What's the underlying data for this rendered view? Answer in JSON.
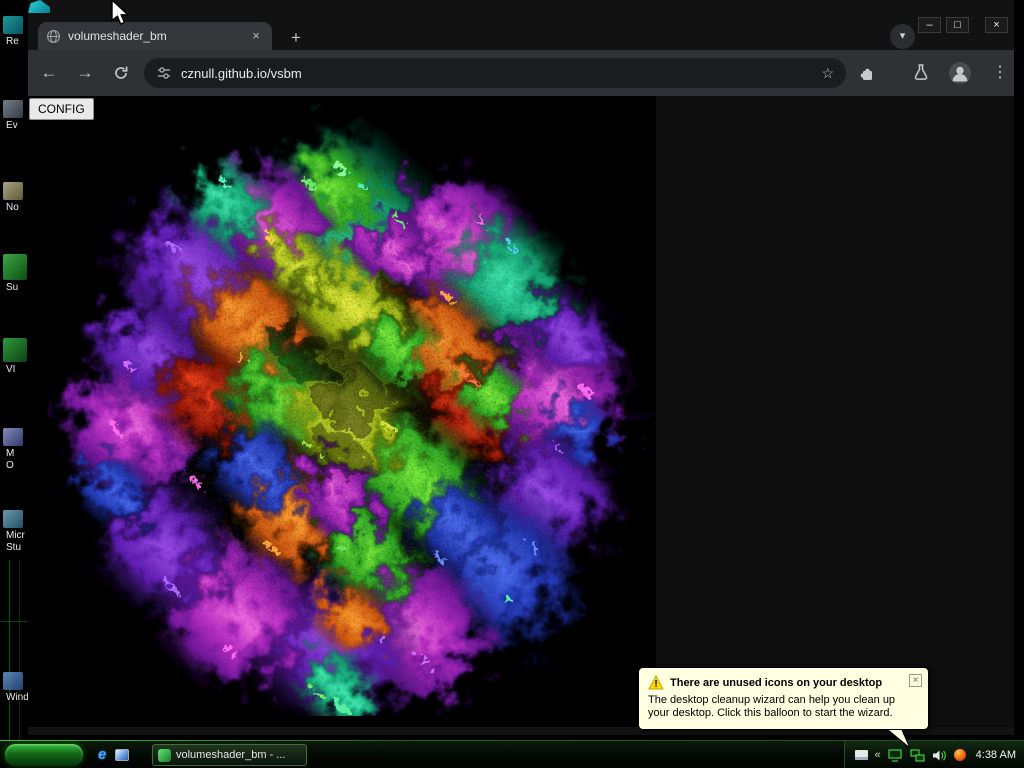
{
  "browser": {
    "tab_title": "volumeshader_bm",
    "url": "cznull.github.io/vsbm"
  },
  "glyphs": {
    "back": "←",
    "forward": "→",
    "minimize": "–",
    "maximize": "□",
    "close": "×",
    "tab_close": "×",
    "new_tab": "+",
    "chevron_down": "▾",
    "star": "☆",
    "menu": "⋮",
    "balloon_close": "×",
    "warning_mark": "!",
    "ie": "e",
    "tray_expand": "«"
  },
  "page": {
    "config_label": "CONFIG"
  },
  "balloon": {
    "title": "There are unused icons on your desktop",
    "body": "The desktop cleanup wizard can help you clean up your desktop. Click this balloon to start the wizard."
  },
  "taskbar": {
    "app_button_label": "volumeshader_bm - ...",
    "clock": "4:38 AM"
  },
  "desktop": {
    "icons": [
      {
        "line1": "Re"
      },
      {
        "line1": "Ev"
      },
      {
        "line1": "No"
      },
      {
        "line1": "Su"
      },
      {
        "line1": "VI"
      },
      {
        "line1": "M",
        "line2": "O"
      },
      {
        "line1": "Micr",
        "line2": "Stu"
      },
      {
        "line1": "Wind"
      }
    ]
  },
  "colors": {
    "balloon_bg": "#ffffe1",
    "toolbar": "#303134",
    "omnibox": "#1b1c1e",
    "frame": "#121212",
    "page_bg": "#000000",
    "accent_green": "#18a018",
    "url_text": "#e8eaed"
  }
}
